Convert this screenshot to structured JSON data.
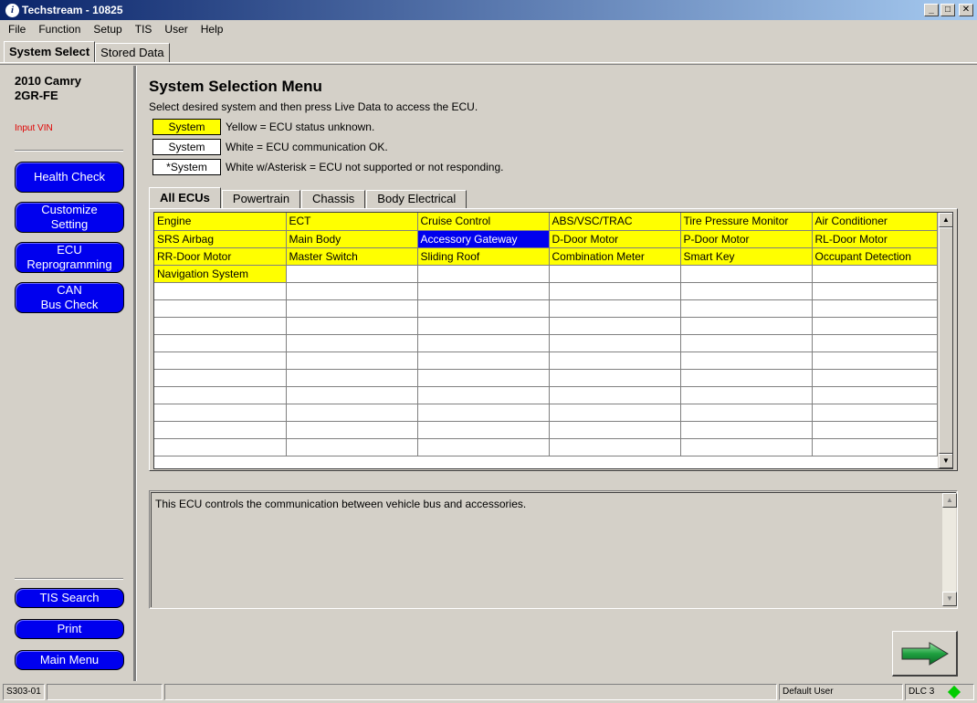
{
  "window": {
    "title": "Techstream - 10825",
    "minimize": "_",
    "maximize": "□",
    "close": "✕"
  },
  "menu": [
    "File",
    "Function",
    "Setup",
    "TIS",
    "User",
    "Help"
  ],
  "top_tabs": [
    {
      "label": "System Select",
      "active": true
    },
    {
      "label": "Stored Data",
      "active": false
    }
  ],
  "sidebar": {
    "vehicle_line1": "2010 Camry",
    "vehicle_line2": "2GR-FE",
    "input_vin": "Input VIN",
    "buttons": [
      "Health Check",
      "Customize\nSetting",
      "ECU\nReprogramming",
      "CAN\nBus Check"
    ],
    "bottom_buttons": [
      "TIS Search",
      "Print",
      "Main Menu"
    ]
  },
  "main": {
    "title": "System Selection Menu",
    "instruction": "Select desired system and then press Live Data to access the ECU.",
    "legend": [
      {
        "box": "System",
        "style": "yellow",
        "text": "Yellow = ECU status unknown."
      },
      {
        "box": "System",
        "style": "white",
        "text": "White = ECU communication OK."
      },
      {
        "box": "*System",
        "style": "white",
        "text": "White w/Asterisk = ECU not supported or not responding."
      }
    ],
    "ecu_tabs": [
      {
        "label": "All ECUs",
        "active": true
      },
      {
        "label": "Powertrain",
        "active": false
      },
      {
        "label": "Chassis",
        "active": false
      },
      {
        "label": "Body Electrical",
        "active": false
      }
    ],
    "ecus": [
      [
        "Engine",
        "ECT",
        "Cruise Control",
        "ABS/VSC/TRAC",
        "Tire Pressure Monitor",
        "Air Conditioner"
      ],
      [
        "SRS Airbag",
        "Main Body",
        "Accessory Gateway",
        "D-Door Motor",
        "P-Door Motor",
        "RL-Door Motor"
      ],
      [
        "RR-Door Motor",
        "Master Switch",
        "Sliding Roof",
        "Combination Meter",
        "Smart Key",
        "Occupant Detection"
      ],
      [
        "Navigation System",
        "",
        "",
        "",
        "",
        ""
      ]
    ],
    "selected_ecu": "Accessory Gateway",
    "description": "This ECU controls the communication between vehicle bus and accessories."
  },
  "statusbar": {
    "code": "S303-01",
    "user": "Default User",
    "connection": "DLC 3"
  },
  "colors": {
    "yellow": "#ffff00",
    "blue_button": "#0000ee",
    "selected": "#0000ee",
    "status_led": "#00cc00"
  }
}
